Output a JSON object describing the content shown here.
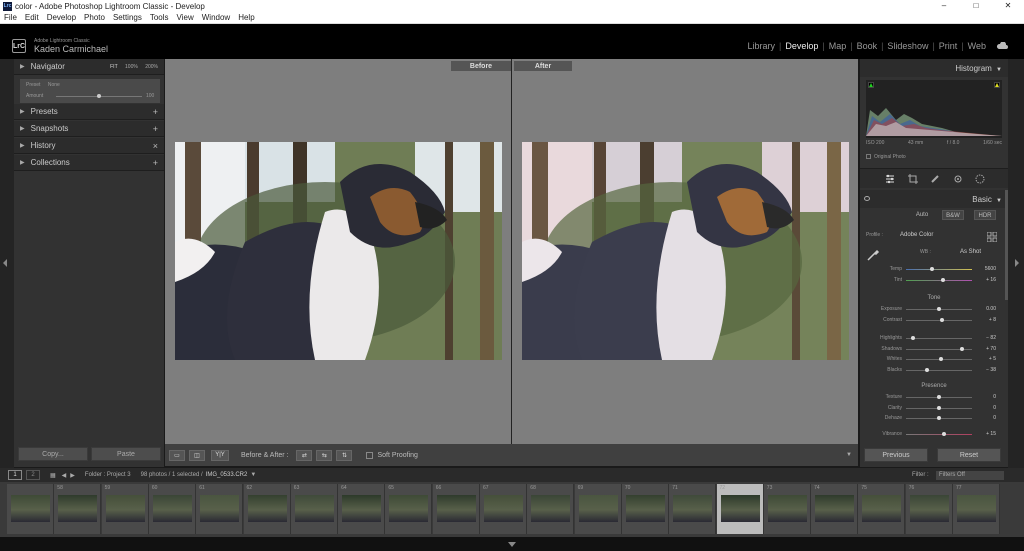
{
  "window": {
    "title": "color - Adobe Photoshop Lightroom Classic - Develop",
    "logo": "Lrc"
  },
  "menu": [
    "File",
    "Edit",
    "Develop",
    "Photo",
    "Settings",
    "Tools",
    "View",
    "Window",
    "Help"
  ],
  "identity": {
    "app_name": "Adobe Lightroom Classic",
    "user": "Kaden Carmichael",
    "badge": "LrC"
  },
  "modules": {
    "items": [
      "Library",
      "Develop",
      "Map",
      "Book",
      "Slideshow",
      "Print",
      "Web"
    ],
    "active": "Develop"
  },
  "left_panel": {
    "navigator": {
      "label": "Navigator",
      "zoom_options": [
        "FIT",
        "100%",
        "200%"
      ]
    },
    "preset_preview": {
      "preset_label": "Preset",
      "preset_value": "None",
      "amount_label": "Amount",
      "amount_value": "100"
    },
    "sections": [
      {
        "label": "Presets",
        "action": "+"
      },
      {
        "label": "Snapshots",
        "action": "+"
      },
      {
        "label": "History",
        "action": "×"
      },
      {
        "label": "Collections",
        "action": "+"
      }
    ],
    "copy_label": "Copy...",
    "paste_label": "Paste"
  },
  "view": {
    "before_label": "Before",
    "after_label": "After"
  },
  "toolbar": {
    "before_after_label": "Before & After :",
    "yy_label": "Y|Y",
    "soft_proofing_label": "Soft Proofing"
  },
  "right_panel": {
    "histogram_label": "Histogram",
    "histo_info": {
      "iso": "ISO 200",
      "focal": "43 mm",
      "aperture": "f / 8.0",
      "shutter": "1/60 sec"
    },
    "original_photo_label": "Original Photo",
    "basic_label": "Basic",
    "treatment": {
      "auto": "Auto",
      "bw": "B&W",
      "hdr": "HDR"
    },
    "profile": {
      "label": "Profile :",
      "value": "Adobe Color"
    },
    "wb": {
      "label": "WB :",
      "value": "As Shot"
    },
    "temp": {
      "label": "Temp",
      "value": "5600"
    },
    "tint": {
      "label": "Tint",
      "value": "+ 16"
    },
    "tone_title": "Tone",
    "exposure": {
      "label": "Exposure",
      "value": "0.00"
    },
    "contrast": {
      "label": "Contrast",
      "value": "+ 8"
    },
    "highlights": {
      "label": "Highlights",
      "value": "− 82"
    },
    "shadows": {
      "label": "Shadows",
      "value": "+ 70"
    },
    "whites": {
      "label": "Whites",
      "value": "+ 5"
    },
    "blacks": {
      "label": "Blacks",
      "value": "− 38"
    },
    "presence_title": "Presence",
    "texture": {
      "label": "Texture",
      "value": "0"
    },
    "clarity": {
      "label": "Clarity",
      "value": "0"
    },
    "dehaze": {
      "label": "Dehaze",
      "value": "0"
    },
    "vibrance": {
      "label": "Vibrance",
      "value": "+ 15"
    },
    "previous_label": "Previous",
    "reset_label": "Reset"
  },
  "filmstrip": {
    "folder": "Folder : Project 3",
    "count": "98 photos / 1 selected /",
    "filename": "IMG_0533.CR2",
    "filter_label": "Filter :",
    "filter_value": "Filters Off",
    "page_buttons": [
      "1",
      "2"
    ],
    "thumb_numbers": [
      "",
      "58",
      "59",
      "60",
      "61",
      "62",
      "63",
      "64",
      "65",
      "66",
      "67",
      "68",
      "69",
      "70",
      "71",
      "72",
      "73",
      "74",
      "75",
      "76",
      "77"
    ]
  },
  "colors": {
    "accent": "#4d4d4d",
    "selected_thumb": "#bcbcbc",
    "panel": "#323232",
    "canvas": "#7e7e7e"
  }
}
